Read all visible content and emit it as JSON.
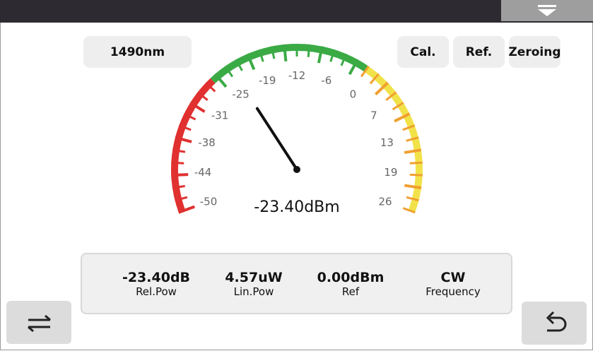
{
  "header": {
    "dropdown_icon": "triangle-down-icon"
  },
  "buttons": {
    "wavelength": "1490nm",
    "cal": "Cal.",
    "ref": "Ref.",
    "zeroing": "Zeroing"
  },
  "gauge": {
    "min": -50,
    "max": 26,
    "value": -23.4,
    "readout": "-23.40dBm",
    "tick_labels": [
      "-50",
      "-44",
      "-38",
      "-31",
      "-25",
      "-19",
      "-12",
      "-6",
      "0",
      "7",
      "13",
      "19",
      "26"
    ],
    "zone_colors": {
      "red": "#e03030",
      "green": "#3aaa45",
      "orange": "#f0a030",
      "yellow": "#f2e24a"
    },
    "needle_color": "#111111"
  },
  "stats": [
    {
      "value": "-23.40dB",
      "label": "Rel.Pow"
    },
    {
      "value": "4.57uW",
      "label": "Lin.Pow"
    },
    {
      "value": "0.00dBm",
      "label": "Ref"
    },
    {
      "value": "CW",
      "label": "Frequency"
    }
  ],
  "nav": {
    "swap_icon": "swap-arrows-icon",
    "back_icon": "return-arrow-icon"
  }
}
